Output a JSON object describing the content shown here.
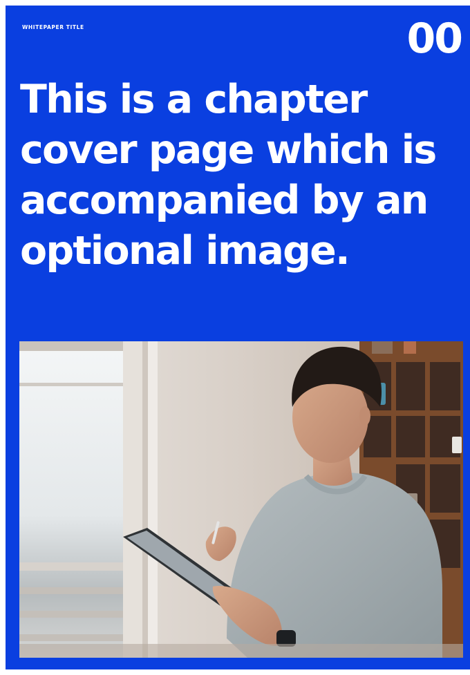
{
  "header": {
    "eyebrow": "WHITEPAPER TITLE",
    "chapter_number": "00"
  },
  "headline": "This is a chapter cover page which is accompanied by an optional image.",
  "colors": {
    "background": "#0a3fe0",
    "text": "#ffffff"
  }
}
